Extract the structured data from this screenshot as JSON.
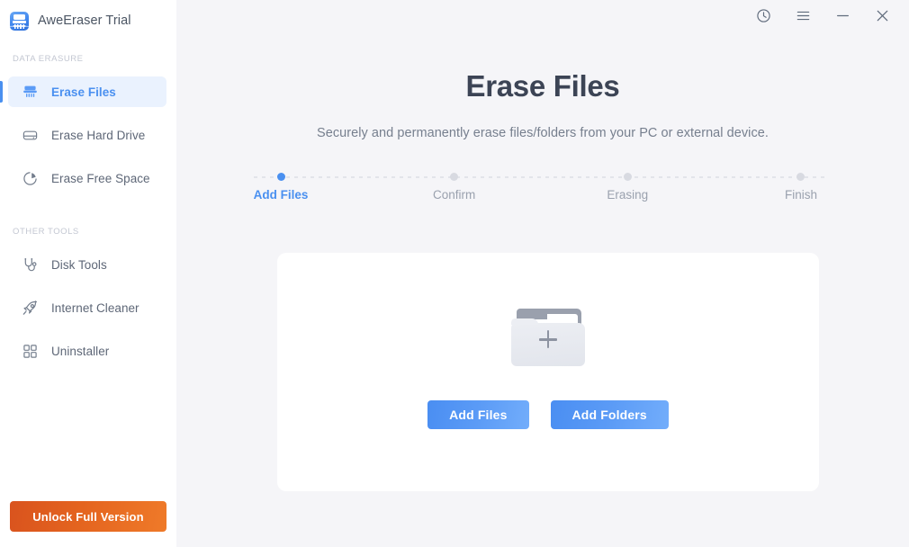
{
  "app": {
    "title": "AweEraser Trial",
    "logo_icon": "shredder-icon"
  },
  "titlebar": {
    "buttons": [
      {
        "name": "history-icon",
        "label": "History"
      },
      {
        "name": "menu-icon",
        "label": "Menu"
      },
      {
        "name": "minimize-icon",
        "label": "Minimize"
      },
      {
        "name": "close-icon",
        "label": "Close"
      }
    ]
  },
  "sidebar": {
    "sections": [
      {
        "label": "DATA ERASURE",
        "items": [
          {
            "label": "Erase Files",
            "icon": "shredder-icon",
            "active": true
          },
          {
            "label": "Erase Hard Drive",
            "icon": "harddrive-icon",
            "active": false
          },
          {
            "label": "Erase Free Space",
            "icon": "piechart-icon",
            "active": false
          }
        ]
      },
      {
        "label": "OTHER TOOLS",
        "items": [
          {
            "label": "Disk Tools",
            "icon": "stethoscope-icon",
            "active": false
          },
          {
            "label": "Internet Cleaner",
            "icon": "rocket-icon",
            "active": false
          },
          {
            "label": "Uninstaller",
            "icon": "grid-icon",
            "active": false
          }
        ]
      }
    ],
    "unlock_label": "Unlock Full Version"
  },
  "main": {
    "title": "Erase Files",
    "subtitle": "Securely and permanently erase files/folders from your PC or external device.",
    "steps": [
      {
        "label": "Add Files",
        "state": "active"
      },
      {
        "label": "Confirm",
        "state": "pending"
      },
      {
        "label": "Erasing",
        "state": "pending"
      },
      {
        "label": "Finish",
        "state": "pending"
      }
    ],
    "drop_card": {
      "icon": "add-folder-icon",
      "add_files_label": "Add Files",
      "add_folders_label": "Add Folders"
    }
  },
  "colors": {
    "accent_blue": "#4a90f0",
    "unlock_orange": "#e4641f",
    "sidebar_bg": "#ffffff",
    "main_bg": "#f5f5f8",
    "card_bg": "#ffffff",
    "muted_text": "#9aa1ae"
  }
}
